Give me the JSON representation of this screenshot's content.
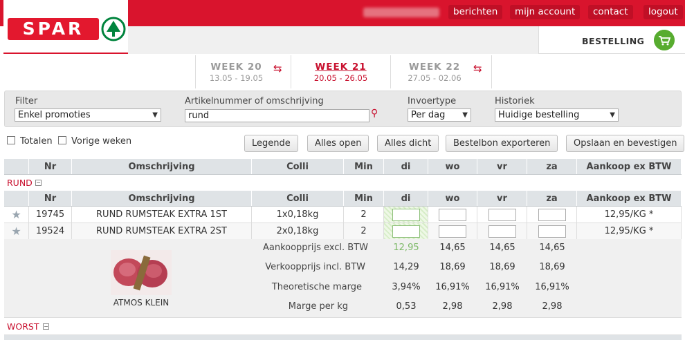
{
  "header": {
    "logo_text": "SPAR",
    "nav": [
      "berichten",
      "mijn account",
      "contact",
      "logout"
    ],
    "order_label": "BESTELLING",
    "cart_icon": "shopping-cart-icon",
    "brand_color": "#d9142d"
  },
  "weeks": [
    {
      "label": "WEEK 20",
      "dates": "13.05 - 19.05",
      "active": false
    },
    {
      "label": "WEEK 21",
      "dates": "20.05 - 26.05",
      "active": true
    },
    {
      "label": "WEEK 22",
      "dates": "27.05 - 02.06",
      "active": false
    }
  ],
  "filter": {
    "filter_label": "Filter",
    "filter_value": "Enkel promoties",
    "search_label": "Artikelnummer of omschrijving",
    "search_value": "rund",
    "input_label": "Invoertype",
    "input_value": "Per dag",
    "history_label": "Historiek",
    "history_value": "Huidige bestelling"
  },
  "options": {
    "totals": "Totalen",
    "prev_weeks": "Vorige weken"
  },
  "buttons": [
    "Legende",
    "Alles open",
    "Alles dicht",
    "Bestelbon exporteren",
    "Opslaan en bevestigen"
  ],
  "columns": [
    "Nr",
    "Omschrijving",
    "Colli",
    "Min",
    "di",
    "wo",
    "vr",
    "za",
    "Aankoop ex BTW"
  ],
  "categories": {
    "first": "RUND",
    "second": "WORST"
  },
  "rows": [
    {
      "nr": "19745",
      "desc": "RUND RUMSTEAK EXTRA 1ST",
      "colli": "1x0,18kg",
      "min": "2",
      "price": "12,95/KG *"
    },
    {
      "nr": "19524",
      "desc": "RUND RUMSTEAK EXTRA 2ST",
      "colli": "2x0,18kg",
      "min": "2",
      "price": "12,95/KG *"
    }
  ],
  "detail": {
    "product_name": "ATMOS KLEIN",
    "labels": [
      "Aankoopprijs excl. BTW",
      "Verkoopprijs incl. BTW",
      "Theoretische marge",
      "Marge per kg"
    ],
    "values": [
      [
        "12,95",
        "14,65",
        "14,65",
        "14,65"
      ],
      [
        "14,29",
        "18,69",
        "18,69",
        "18,69"
      ],
      [
        "3,94%",
        "16,91%",
        "16,91%",
        "16,91%"
      ],
      [
        "0,53",
        "2,98",
        "2,98",
        "2,98"
      ]
    ]
  }
}
